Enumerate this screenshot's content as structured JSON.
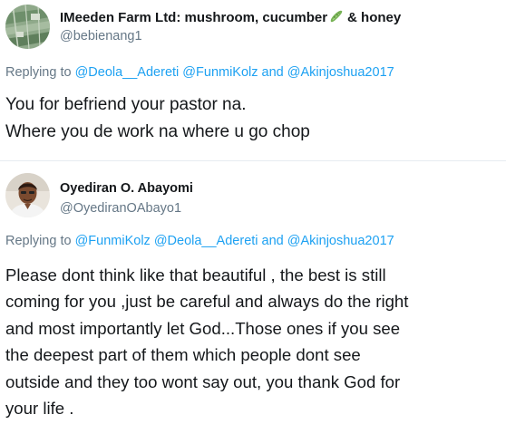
{
  "tweets": [
    {
      "display_name": "IMeeden Farm Ltd: mushroom, cucumber",
      "display_name_emoji": "cucumber-emoji",
      "display_name_suffix": "& honey",
      "handle": "@bebienang1",
      "replying_to_prefix": "Replying to",
      "replying_to": [
        "@Deola__Adereti",
        "@FunmiKolz",
        "and",
        "@Akinjoshua2017"
      ],
      "body_lines": [
        "You for befriend your pastor na.",
        "Where you de work na where u go chop"
      ]
    },
    {
      "display_name": "Oyediran O. Abayomi",
      "handle": "@OyediranOAbayo1",
      "replying_to_prefix": "Replying to",
      "replying_to": [
        "@FunmiKolz",
        "@Deola__Adereti",
        "and",
        "@Akinjoshua2017"
      ],
      "body_lines": [
        "Please dont think like that beautiful , the best is still",
        "coming for you ,just be careful and always do the right",
        "and most importantly let God...Those ones if you see",
        "the deepest part of them which people dont see",
        "outside and they too wont say out, you thank God for",
        "your life ."
      ]
    }
  ],
  "colors": {
    "link": "#1da1f2",
    "secondary_text": "#657786",
    "primary_text": "#14171a",
    "divider": "#e6ecf0"
  }
}
